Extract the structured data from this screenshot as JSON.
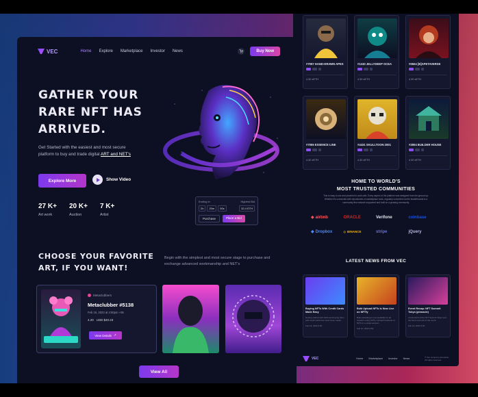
{
  "colors": {
    "accent": "#7c3aed",
    "accent2": "#d946a8",
    "panel": "#0d0f22",
    "card": "#15172e"
  },
  "nav": {
    "logo_text": "VEC",
    "links": [
      "Home",
      "Explore",
      "Marketplace",
      "Investor",
      "News"
    ],
    "active": "Home",
    "cart_icon": "cart-icon",
    "buy_label": "Buy Now"
  },
  "hero": {
    "title_lines": [
      "GATHER YOUR",
      "RARE NFT HAS",
      "ARRIVED."
    ],
    "subtitle_pre": "Get Started with the easiest and most secure platform to buy and trade digital",
    "subtitle_link": "ART and NET's",
    "explore_label": "Explore More",
    "video_label": "Show Video",
    "stats": [
      {
        "num": "27 K+",
        "label": "Art work"
      },
      {
        "num": "20 K+",
        "label": "Auction"
      },
      {
        "num": "7 K+",
        "label": "Artist"
      }
    ],
    "bid": {
      "left_label": "Ending in",
      "right_label": "Highest Bid",
      "timer": [
        "2h",
        "20m",
        "50s"
      ],
      "eth": "32.4 ETH",
      "purchase_label": "Purchase",
      "place_bid_label": "Place a Bid"
    }
  },
  "choose": {
    "title_lines": [
      "CHOOSE YOUR FAVORITE",
      "ART, IF YOU WANT!"
    ],
    "desc": "Begin with the simplest and most secure stage to purchase and exchange advanced workmanship and NET's",
    "featured": {
      "owner": "Metaclubbers",
      "name": "Metaclubber #5138",
      "date": "Feb 16, 2023 at 4:50pm +06",
      "price_eth": "4.20",
      "price_usd": "USD $40.23",
      "details_label": "View Details"
    },
    "view_all_label": "View All"
  },
  "nfts": [
    {
      "title": "#7097 HAND-DRAWN APES",
      "price": "4.30 eETH"
    },
    {
      "title": "#1240 JELLYDEEP OCEA",
      "price": "4.30 eETH"
    },
    {
      "title": "#0604 [B]APETAVERSE",
      "price": "4.30 eETH"
    },
    {
      "title": "#7055 ESSENCE LINE",
      "price": "4.30 eETH"
    },
    {
      "title": "#4431 SKULLTOON 2001",
      "price": "4.30 eETH"
    },
    {
      "title": "#2804 BUILDER HOUSE",
      "price": "4.30 eETH"
    }
  ],
  "home": {
    "title_lines": [
      "HOME TO WORLD'S",
      "MOST TRUSTED COMMUNITIES"
    ],
    "desc": "This is easy to use and powerful to work with. Every aspect of the platform was designed from the ground up. Whether it's connected with repositories or marketplace tools, regularly converted via the leaderboards is a community-first network supported and built on a growing community."
  },
  "brands": [
    "airbnb",
    "ORACLE",
    "Verifone",
    "coinbase",
    "Dropbox",
    "BINANCE",
    "stripe",
    "jQuery"
  ],
  "news": {
    "title": "LATEST NEWS FROM VEC",
    "items": [
      {
        "title": "Buying NFTs With Credit Cards Made Easy",
        "meta": "Getting started with NFTs and buying them with credit cards has never been easier.",
        "date": "Feb 16, 2023 4:50"
      },
      {
        "title": "Bulk Upload NFTs Is Now Live on NFTfy",
        "meta": "Bulk uploading is now available for all creators using NFTfy. Upload hundreds of NFTs in a single session.",
        "date": "Feb 16, 2023 4:50"
      },
      {
        "title": "Event Recap: NFT Summit Tokyo (pinnacle)",
        "meta": "A look back at the NFT Summit Tokyo and the best moments of the event.",
        "date": "Feb 16, 2023 4:50"
      }
    ]
  },
  "footer": {
    "logo_text": "VEC",
    "links": [
      "Home",
      "Marketplace",
      "Investor",
      "News"
    ],
    "copy": "© Vec company enterprise. All rights reserved."
  }
}
